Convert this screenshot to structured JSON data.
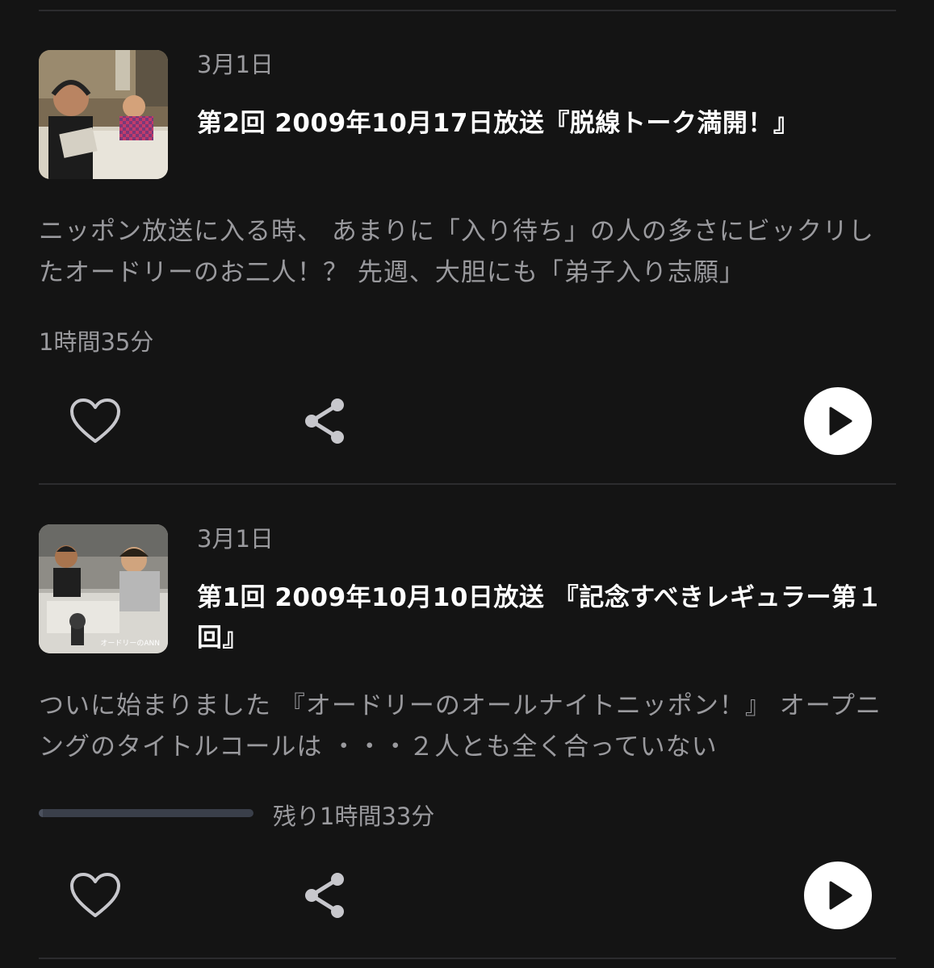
{
  "episodes": [
    {
      "date": "3月1日",
      "title": "第2回 2009年10月17日放送『脱線トーク満開！』",
      "description": "ニッポン放送に入る時、 あまりに「入り待ち」の人の多さにビックリしたオードリーのお二人！？ 先週、大胆にも「弟子入り志願」",
      "duration": "1時間35分",
      "thumbnail_caption": ""
    },
    {
      "date": "3月1日",
      "title": "第1回 2009年10月10日放送 『記念すべきレギュラー第１回』",
      "description": "ついに始まりました 『オードリーのオールナイトニッポン！』 オープニングのタイトルコールは ・・・２人とも全く合っていない",
      "progress": 0.02,
      "remaining": "残り1時間33分",
      "thumbnail_caption": "オードリーのANN"
    }
  ],
  "icons": {
    "favorite": "heart-outline-icon",
    "share": "share-icon",
    "play": "play-circle-icon"
  },
  "colors": {
    "background": "#141414",
    "title": "#ffffff",
    "secondary_text": "#9a9a9e",
    "divider": "#2c2c2e",
    "progress_track": "#3a3f4a",
    "icon": "#c7c7cc"
  }
}
